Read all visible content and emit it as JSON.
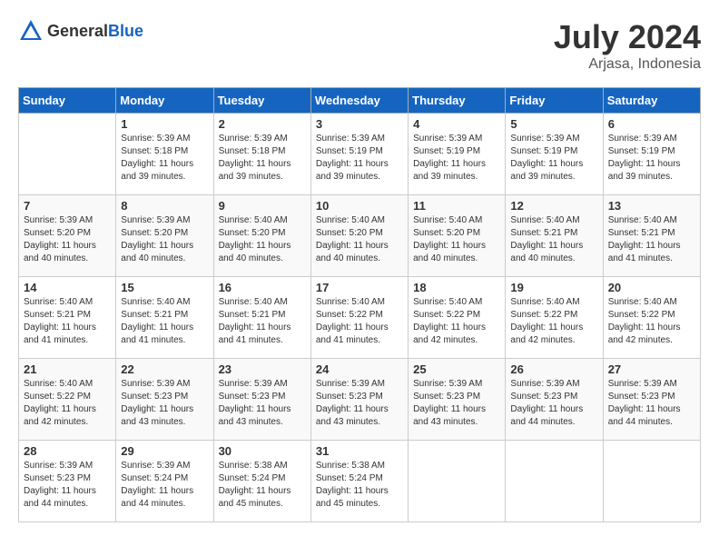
{
  "header": {
    "logo_general": "General",
    "logo_blue": "Blue",
    "month": "July 2024",
    "location": "Arjasa, Indonesia"
  },
  "days_of_week": [
    "Sunday",
    "Monday",
    "Tuesday",
    "Wednesday",
    "Thursday",
    "Friday",
    "Saturday"
  ],
  "weeks": [
    [
      {
        "day": "",
        "info": ""
      },
      {
        "day": "1",
        "info": "Sunrise: 5:39 AM\nSunset: 5:18 PM\nDaylight: 11 hours\nand 39 minutes."
      },
      {
        "day": "2",
        "info": "Sunrise: 5:39 AM\nSunset: 5:18 PM\nDaylight: 11 hours\nand 39 minutes."
      },
      {
        "day": "3",
        "info": "Sunrise: 5:39 AM\nSunset: 5:19 PM\nDaylight: 11 hours\nand 39 minutes."
      },
      {
        "day": "4",
        "info": "Sunrise: 5:39 AM\nSunset: 5:19 PM\nDaylight: 11 hours\nand 39 minutes."
      },
      {
        "day": "5",
        "info": "Sunrise: 5:39 AM\nSunset: 5:19 PM\nDaylight: 11 hours\nand 39 minutes."
      },
      {
        "day": "6",
        "info": "Sunrise: 5:39 AM\nSunset: 5:19 PM\nDaylight: 11 hours\nand 39 minutes."
      }
    ],
    [
      {
        "day": "7",
        "info": "Sunrise: 5:39 AM\nSunset: 5:20 PM\nDaylight: 11 hours\nand 40 minutes."
      },
      {
        "day": "8",
        "info": "Sunrise: 5:39 AM\nSunset: 5:20 PM\nDaylight: 11 hours\nand 40 minutes."
      },
      {
        "day": "9",
        "info": "Sunrise: 5:40 AM\nSunset: 5:20 PM\nDaylight: 11 hours\nand 40 minutes."
      },
      {
        "day": "10",
        "info": "Sunrise: 5:40 AM\nSunset: 5:20 PM\nDaylight: 11 hours\nand 40 minutes."
      },
      {
        "day": "11",
        "info": "Sunrise: 5:40 AM\nSunset: 5:20 PM\nDaylight: 11 hours\nand 40 minutes."
      },
      {
        "day": "12",
        "info": "Sunrise: 5:40 AM\nSunset: 5:21 PM\nDaylight: 11 hours\nand 40 minutes."
      },
      {
        "day": "13",
        "info": "Sunrise: 5:40 AM\nSunset: 5:21 PM\nDaylight: 11 hours\nand 41 minutes."
      }
    ],
    [
      {
        "day": "14",
        "info": "Sunrise: 5:40 AM\nSunset: 5:21 PM\nDaylight: 11 hours\nand 41 minutes."
      },
      {
        "day": "15",
        "info": "Sunrise: 5:40 AM\nSunset: 5:21 PM\nDaylight: 11 hours\nand 41 minutes."
      },
      {
        "day": "16",
        "info": "Sunrise: 5:40 AM\nSunset: 5:21 PM\nDaylight: 11 hours\nand 41 minutes."
      },
      {
        "day": "17",
        "info": "Sunrise: 5:40 AM\nSunset: 5:22 PM\nDaylight: 11 hours\nand 41 minutes."
      },
      {
        "day": "18",
        "info": "Sunrise: 5:40 AM\nSunset: 5:22 PM\nDaylight: 11 hours\nand 42 minutes."
      },
      {
        "day": "19",
        "info": "Sunrise: 5:40 AM\nSunset: 5:22 PM\nDaylight: 11 hours\nand 42 minutes."
      },
      {
        "day": "20",
        "info": "Sunrise: 5:40 AM\nSunset: 5:22 PM\nDaylight: 11 hours\nand 42 minutes."
      }
    ],
    [
      {
        "day": "21",
        "info": "Sunrise: 5:40 AM\nSunset: 5:22 PM\nDaylight: 11 hours\nand 42 minutes."
      },
      {
        "day": "22",
        "info": "Sunrise: 5:39 AM\nSunset: 5:23 PM\nDaylight: 11 hours\nand 43 minutes."
      },
      {
        "day": "23",
        "info": "Sunrise: 5:39 AM\nSunset: 5:23 PM\nDaylight: 11 hours\nand 43 minutes."
      },
      {
        "day": "24",
        "info": "Sunrise: 5:39 AM\nSunset: 5:23 PM\nDaylight: 11 hours\nand 43 minutes."
      },
      {
        "day": "25",
        "info": "Sunrise: 5:39 AM\nSunset: 5:23 PM\nDaylight: 11 hours\nand 43 minutes."
      },
      {
        "day": "26",
        "info": "Sunrise: 5:39 AM\nSunset: 5:23 PM\nDaylight: 11 hours\nand 44 minutes."
      },
      {
        "day": "27",
        "info": "Sunrise: 5:39 AM\nSunset: 5:23 PM\nDaylight: 11 hours\nand 44 minutes."
      }
    ],
    [
      {
        "day": "28",
        "info": "Sunrise: 5:39 AM\nSunset: 5:23 PM\nDaylight: 11 hours\nand 44 minutes."
      },
      {
        "day": "29",
        "info": "Sunrise: 5:39 AM\nSunset: 5:24 PM\nDaylight: 11 hours\nand 44 minutes."
      },
      {
        "day": "30",
        "info": "Sunrise: 5:38 AM\nSunset: 5:24 PM\nDaylight: 11 hours\nand 45 minutes."
      },
      {
        "day": "31",
        "info": "Sunrise: 5:38 AM\nSunset: 5:24 PM\nDaylight: 11 hours\nand 45 minutes."
      },
      {
        "day": "",
        "info": ""
      },
      {
        "day": "",
        "info": ""
      },
      {
        "day": "",
        "info": ""
      }
    ]
  ]
}
